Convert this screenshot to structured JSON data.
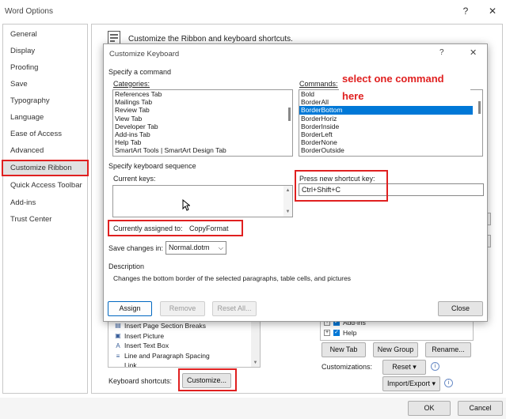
{
  "window": {
    "title": "Word Options",
    "minimize": "?",
    "close": "✕",
    "header": "Customize the Ribbon and keyboard shortcuts."
  },
  "sidebar": {
    "items": [
      {
        "label": "General"
      },
      {
        "label": "Display"
      },
      {
        "label": "Proofing"
      },
      {
        "label": "Save"
      },
      {
        "label": "Typography"
      },
      {
        "label": "Language"
      },
      {
        "label": "Ease of Access"
      },
      {
        "label": "Advanced"
      },
      {
        "label": "Customize Ribbon"
      },
      {
        "label": "Quick Access Toolbar"
      },
      {
        "label": "Add-ins"
      },
      {
        "label": "Trust Center"
      }
    ],
    "selected": "Customize Ribbon"
  },
  "behind": {
    "left_list": [
      "Insert Page  Section Breaks",
      "Insert Picture",
      "Insert Text Box",
      "Line and Paragraph Spacing",
      "Link"
    ],
    "right_tree": [
      "Add-ins",
      "Help"
    ],
    "new_tab": "New Tab",
    "new_group": "New Group",
    "rename": "Rename...",
    "customizations_label": "Customizations:",
    "reset": "Reset ▾",
    "import_export": "Import/Export ▾",
    "info": "i",
    "keyboard_shortcuts_label": "Keyboard shortcuts:",
    "customize": "Customize..."
  },
  "footer": {
    "ok": "OK",
    "cancel": "Cancel"
  },
  "dialog": {
    "title": "Customize Keyboard",
    "help": "?",
    "close": "✕",
    "specify_command": "Specify a command",
    "categories_label": "Categories:",
    "categories": [
      "References Tab",
      "Mailings Tab",
      "Review Tab",
      "View Tab",
      "Developer Tab",
      "Add-ins Tab",
      "Help Tab",
      "SmartArt Tools | SmartArt Design Tab"
    ],
    "commands_label": "Commands:",
    "commands": [
      "Bold",
      "BorderAll",
      "BorderBottom",
      "BorderHoriz",
      "BorderInside",
      "BorderLeft",
      "BorderNone",
      "BorderOutside"
    ],
    "selected_command": "BorderBottom",
    "annotation_line1": "select one command",
    "annotation_line2": "here",
    "specify_sequence": "Specify keyboard sequence",
    "current_keys_label": "Current keys:",
    "press_new_label": "Press new shortcut key:",
    "press_new_value": "Ctrl+Shift+C",
    "assigned_label": "Currently assigned to:",
    "assigned_value": "CopyFormat",
    "save_changes_label": "Save changes in:",
    "save_changes_value": "Normal.dotm",
    "description_label": "Description",
    "description_text": "Changes the bottom border of the selected paragraphs, table cells, and pictures",
    "assign": "Assign",
    "remove": "Remove",
    "reset_all": "Reset All...",
    "close_btn": "Close"
  },
  "colors": {
    "annotation_red": "#e02020",
    "selection_blue": "#0078d7"
  }
}
